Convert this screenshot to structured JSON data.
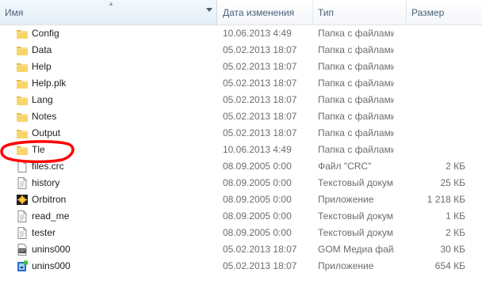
{
  "columns": {
    "name": "Имя",
    "date": "Дата изменения",
    "type": "Тип",
    "size": "Размер"
  },
  "rows": [
    {
      "name": "Config",
      "date": "10.06.2013 4:49",
      "type": "Папка с файлами",
      "size": "",
      "icon": "folder-icon"
    },
    {
      "name": "Data",
      "date": "05.02.2013 18:07",
      "type": "Папка с файлами",
      "size": "",
      "icon": "folder-icon"
    },
    {
      "name": "Help",
      "date": "05.02.2013 18:07",
      "type": "Папка с файлами",
      "size": "",
      "icon": "folder-icon"
    },
    {
      "name": "Help.plk",
      "date": "05.02.2013 18:07",
      "type": "Папка с файлами",
      "size": "",
      "icon": "folder-icon"
    },
    {
      "name": "Lang",
      "date": "05.02.2013 18:07",
      "type": "Папка с файлами",
      "size": "",
      "icon": "folder-icon"
    },
    {
      "name": "Notes",
      "date": "05.02.2013 18:07",
      "type": "Папка с файлами",
      "size": "",
      "icon": "folder-icon"
    },
    {
      "name": "Output",
      "date": "05.02.2013 18:07",
      "type": "Папка с файлами",
      "size": "",
      "icon": "folder-icon"
    },
    {
      "name": "Tle",
      "date": "10.06.2013 4:49",
      "type": "Папка с файлами",
      "size": "",
      "icon": "folder-icon"
    },
    {
      "name": "files.crc",
      "date": "08.09.2005 0:00",
      "type": "Файл \"CRC\"",
      "size": "2 КБ",
      "icon": "file-icon"
    },
    {
      "name": "history",
      "date": "08.09.2005 0:00",
      "type": "Текстовый докум...",
      "size": "25 КБ",
      "icon": "text-file-icon"
    },
    {
      "name": "Orbitron",
      "date": "08.09.2005 0:00",
      "type": "Приложение",
      "size": "1 218 КБ",
      "icon": "app-icon"
    },
    {
      "name": "read_me",
      "date": "08.09.2005 0:00",
      "type": "Текстовый докум...",
      "size": "1 КБ",
      "icon": "text-file-icon"
    },
    {
      "name": "tester",
      "date": "08.09.2005 0:00",
      "type": "Текстовый докум...",
      "size": "2 КБ",
      "icon": "text-file-icon"
    },
    {
      "name": "unins000",
      "date": "05.02.2013 18:07",
      "type": "GOM Медиа файл",
      "size": "30 КБ",
      "icon": "media-file-icon"
    },
    {
      "name": "unins000",
      "date": "05.02.2013 18:07",
      "type": "Приложение",
      "size": "654 КБ",
      "icon": "installer-icon"
    }
  ],
  "highlight": {
    "row": "Tle",
    "color": "#ff0000"
  }
}
